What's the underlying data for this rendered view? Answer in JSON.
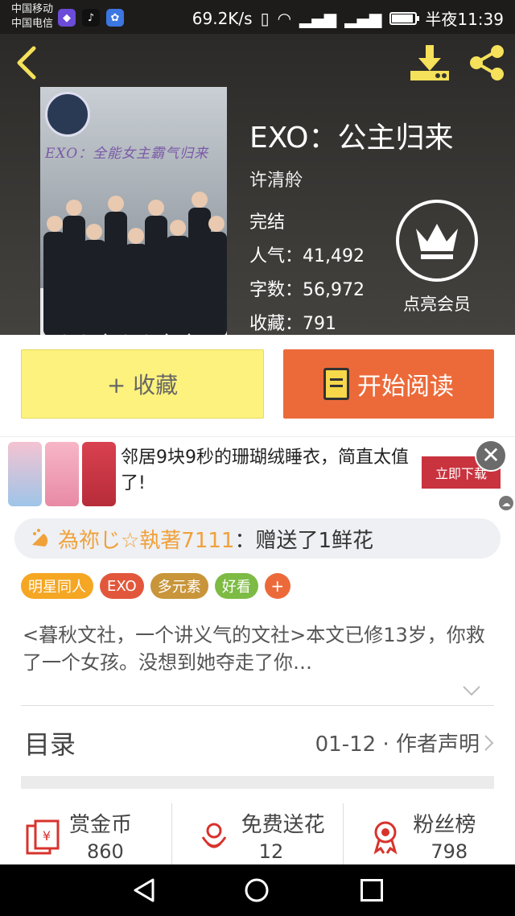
{
  "status_bar": {
    "carrier_1": "中国移动",
    "carrier_2": "中国电信",
    "speed": "69.2K/s",
    "network_1": "2G",
    "network_2": "4G 2G",
    "time": "半夜11:39",
    "battery_level": 0.9
  },
  "book": {
    "title": "EXO：公主归来",
    "cover_title": "EXO：全能女主霸气归来",
    "author": "许清舲",
    "status": "完结",
    "popularity_label": "人气：",
    "popularity": "41,492",
    "words_label": "字数：",
    "words": "56,972",
    "favorites_label": "收藏：",
    "favorites": "791"
  },
  "vip": {
    "label": "点亮会员"
  },
  "actions": {
    "favorite": "+ 收藏",
    "read": "开始阅读"
  },
  "ad": {
    "text": "邻居9块9秒的珊瑚绒睡衣，简直太值了!",
    "cta": "立即下载",
    "close": "✕"
  },
  "gift": {
    "user": "為祢じ☆執著7111",
    "message": "：赠送了1鲜花"
  },
  "tags": [
    {
      "label": "明星同人",
      "color": "#f5a623"
    },
    {
      "label": "EXO",
      "color": "#e2573b"
    },
    {
      "label": "多元素",
      "color": "#c8953a"
    },
    {
      "label": "好看",
      "color": "#7dbb44"
    }
  ],
  "tag_add": "+",
  "description": "<暮秋文社，一个讲义气的文社>本文已修13岁，你救了一个女孩。没想到她夺走了你…",
  "toc": {
    "label": "目录",
    "latest": "01-12 · 作者声明"
  },
  "stats": [
    {
      "label": "赏金币",
      "value": "860",
      "icon": "reward-icon"
    },
    {
      "label": "免费送花",
      "value": "12",
      "icon": "flower-icon"
    },
    {
      "label": "粉丝榜",
      "value": "798",
      "icon": "medal-icon"
    }
  ],
  "colors": {
    "accent_orange": "#ec6a3a",
    "favorite_yellow": "#fdf27d",
    "header_icon_yellow": "#f5e15a",
    "stat_icon_red": "#d7332c"
  }
}
